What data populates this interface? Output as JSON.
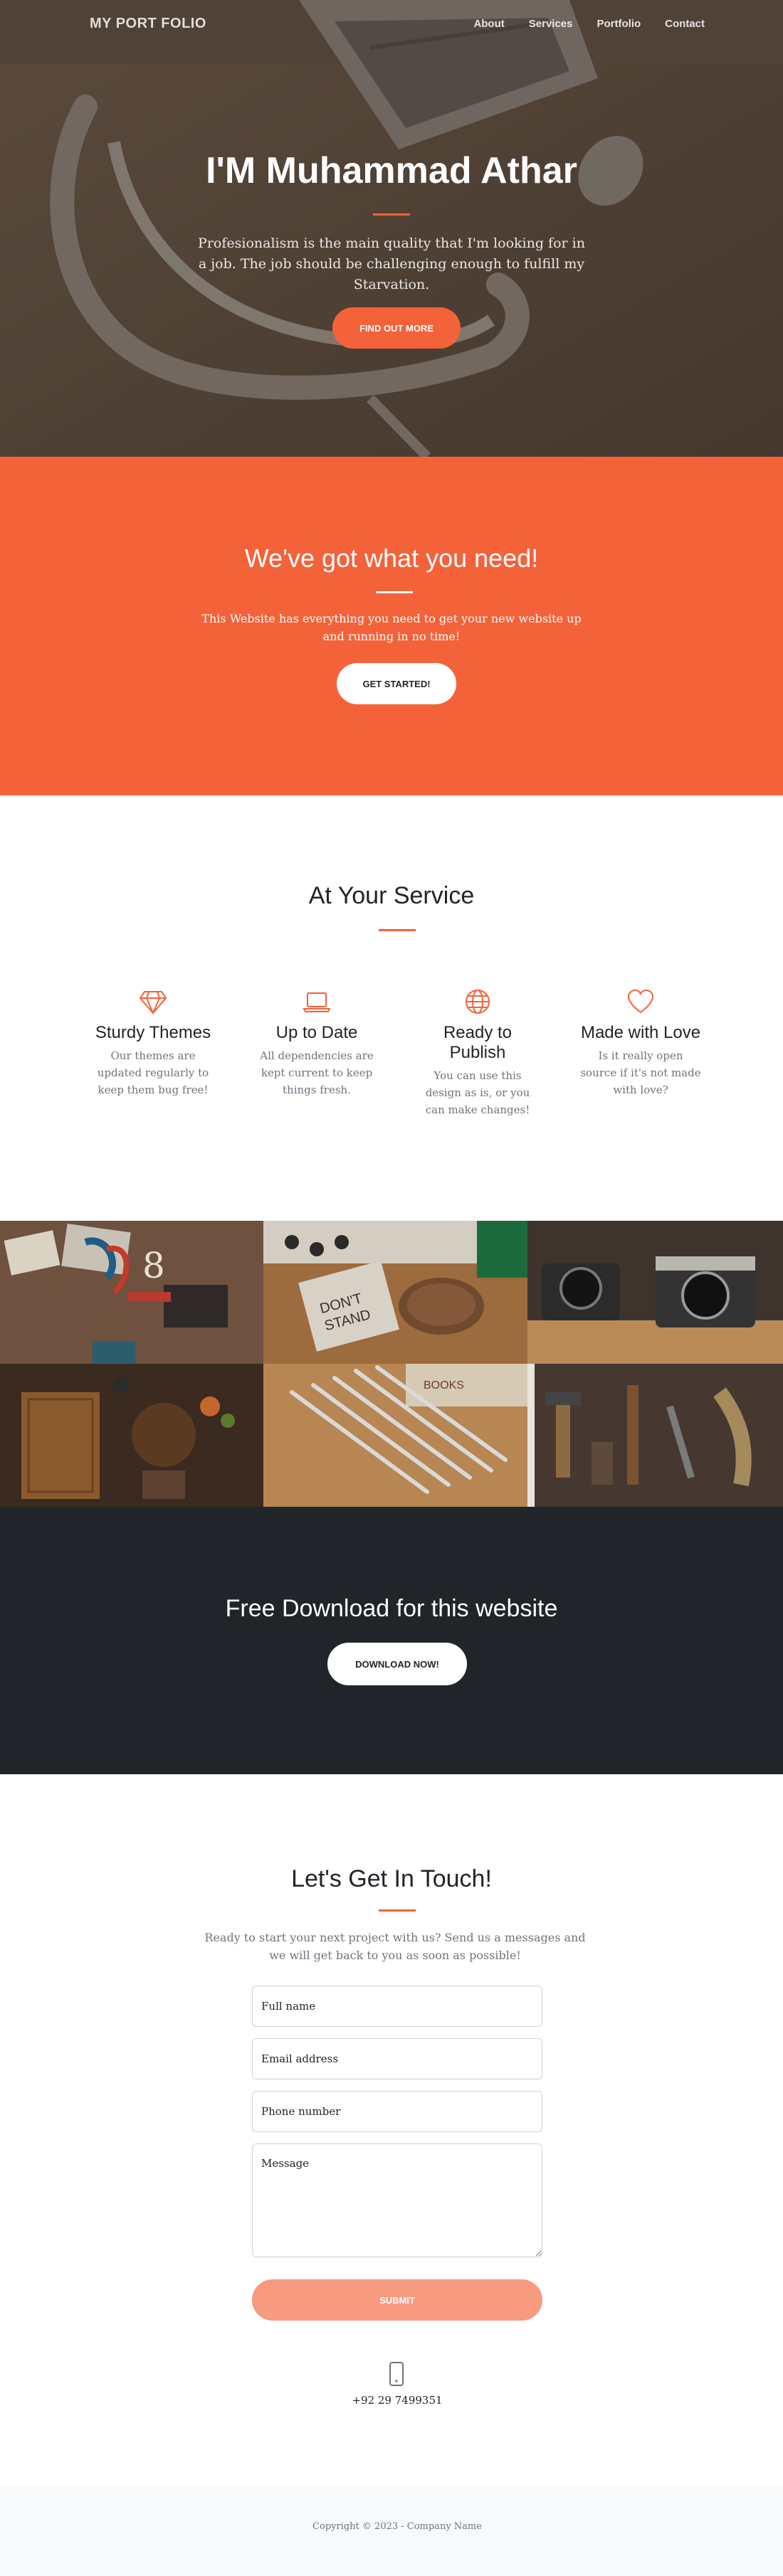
{
  "nav": {
    "brand": "MY PORT FOLIO",
    "links": [
      "About",
      "Services",
      "Portfolio",
      "Contact"
    ]
  },
  "hero": {
    "title": "I'M Muhammad Athar",
    "subtitle": "Profesionalism is the main quality that I'm looking for in a job. The job should be challenging enough to fulfill my Starvation.",
    "button": "FIND OUT MORE"
  },
  "about": {
    "title": "We've got what you need!",
    "text": "This Website has everything you need to get your new website up and running in no time!",
    "button": "GET STARTED!"
  },
  "services": {
    "title": "At Your Service",
    "items": [
      {
        "icon": "gem-icon",
        "title": "Sturdy Themes",
        "text": "Our themes are updated regularly to keep them bug free!"
      },
      {
        "icon": "laptop-icon",
        "title": "Up to Date",
        "text": "All dependencies are kept current to keep things fresh."
      },
      {
        "icon": "globe-icon",
        "title": "Ready to Publish",
        "text": "You can use this design as is, or you can make changes!"
      },
      {
        "icon": "heart-icon",
        "title": "Made with Love",
        "text": "Is it really open source if it's not made with love?"
      }
    ]
  },
  "download": {
    "title": "Free Download for this website",
    "button": "DOWNLOAD NOW!"
  },
  "contact": {
    "title": "Let's Get In Touch!",
    "text": "Ready to start your next project with us? Send us a messages and we will get back to you as soon as possible!",
    "fields": {
      "name_placeholder": "Full name",
      "email_placeholder": "Email address",
      "phone_placeholder": "Phone number",
      "message_placeholder": "Message"
    },
    "submit": "SUBMIT",
    "phone": "+92 29 7499351"
  },
  "footer": {
    "copyright": "Copyright © 2023 - Company Name"
  },
  "colors": {
    "accent": "#f4623a",
    "dark": "#212529",
    "muted": "#6c757d"
  }
}
